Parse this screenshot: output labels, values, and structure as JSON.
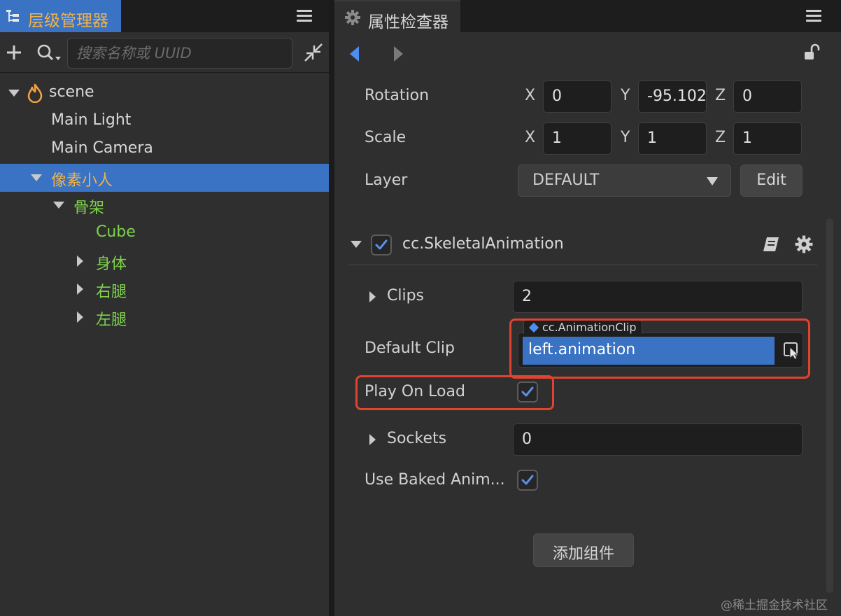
{
  "hierarchy": {
    "tab_title": "层级管理器",
    "search_placeholder": "搜索名称或 UUID",
    "nodes": [
      {
        "label": "scene",
        "color": "#d8d8d8"
      },
      {
        "label": "Main Light",
        "color": "#d8d8d8"
      },
      {
        "label": "Main Camera",
        "color": "#d8d8d8"
      },
      {
        "label": "像素小人",
        "color": "#f0b34a",
        "selected": true
      },
      {
        "label": "骨架",
        "color": "#7cd44b"
      },
      {
        "label": "Cube",
        "color": "#7cd44b"
      },
      {
        "label": "身体",
        "color": "#7cd44b"
      },
      {
        "label": "右腿",
        "color": "#7cd44b"
      },
      {
        "label": "左腿",
        "color": "#7cd44b"
      }
    ]
  },
  "inspector": {
    "tab_title": "属性检查器",
    "rotation": {
      "label": "Rotation",
      "x": "0",
      "y": "-95.102",
      "z": "0"
    },
    "scale": {
      "label": "Scale",
      "x": "1",
      "y": "1",
      "z": "1"
    },
    "axes": {
      "x": "X",
      "y": "Y",
      "z": "Z"
    },
    "layer": {
      "label": "Layer",
      "value": "DEFAULT",
      "edit_label": "Edit"
    },
    "component": {
      "name": "cc.SkeletalAnimation",
      "enabled": true,
      "clips": {
        "label": "Clips",
        "value": "2"
      },
      "default_clip": {
        "label": "Default Clip",
        "asset_type": "cc.AnimationClip",
        "value": "left.animation"
      },
      "play_on_load": {
        "label": "Play On Load",
        "checked": true
      },
      "sockets": {
        "label": "Sockets",
        "value": "0"
      },
      "use_baked_animation": {
        "label": "Use Baked Anim...",
        "checked": true
      }
    },
    "add_component_label": "添加组件"
  },
  "watermark": "@稀土掘金技术社区",
  "colors": {
    "accent_blue": "#3a72c4",
    "highlight_red": "#e0432e",
    "node_green": "#7cd44b",
    "node_orange": "#f0b34a"
  }
}
